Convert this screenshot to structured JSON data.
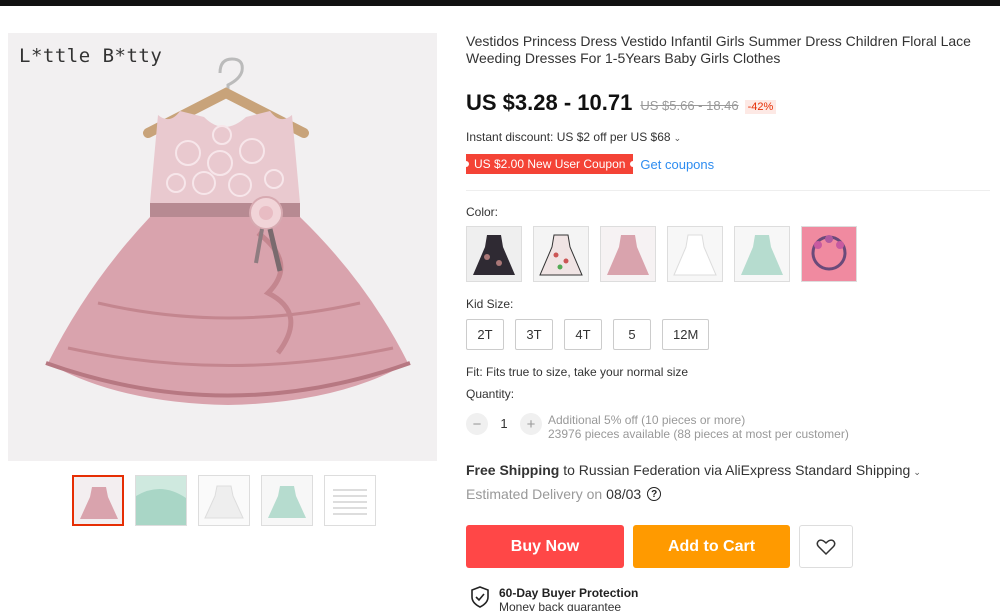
{
  "brand": {
    "logo_text": "L*ttle B*tty"
  },
  "product": {
    "title": "Vestidos Princess Dress Vestido Infantil Girls Summer Dress Children Floral Lace Weeding Dresses For 1-5Years Baby Girls Clothes",
    "price": "US $3.28 - 10.71",
    "old_price": "US $5.66 - 18.46",
    "discount": "-42%",
    "instant_discount": "Instant discount: US $2 off per US $68",
    "coupon": "US $2.00 New User Coupon",
    "get_coupons": "Get coupons"
  },
  "color": {
    "label": "Color:",
    "options": [
      "black-floral",
      "white-print",
      "pink-dress",
      "white-dress",
      "mint-dress",
      "pink-headband"
    ]
  },
  "size": {
    "label": "Kid Size:",
    "options": [
      "2T",
      "3T",
      "4T",
      "5",
      "12M"
    ]
  },
  "fit": "Fit: Fits true to size, take your normal size",
  "quantity": {
    "label": "Quantity:",
    "value": "1",
    "minus": "−",
    "plus": "+",
    "info_line1": "Additional 5% off (10 pieces or more)",
    "info_line2": "23976 pieces available (88 pieces at most per customer)"
  },
  "shipping": {
    "strong": "Free Shipping",
    "rest": "to Russian Federation via AliExpress Standard Shipping",
    "delivery_label": "Estimated Delivery on",
    "delivery_date": "08/03"
  },
  "actions": {
    "buy_now": "Buy Now",
    "add_to_cart": "Add to Cart"
  },
  "protection": {
    "title": "60-Day Buyer Protection",
    "subtitle": "Money back guarantee"
  },
  "colors": {
    "price_red": "#e62e04",
    "buy_now": "#ff4747",
    "add_to_cart": "#ff9a00",
    "link_blue": "#2d8cf0",
    "dress_pink": "#d9a3ad"
  }
}
